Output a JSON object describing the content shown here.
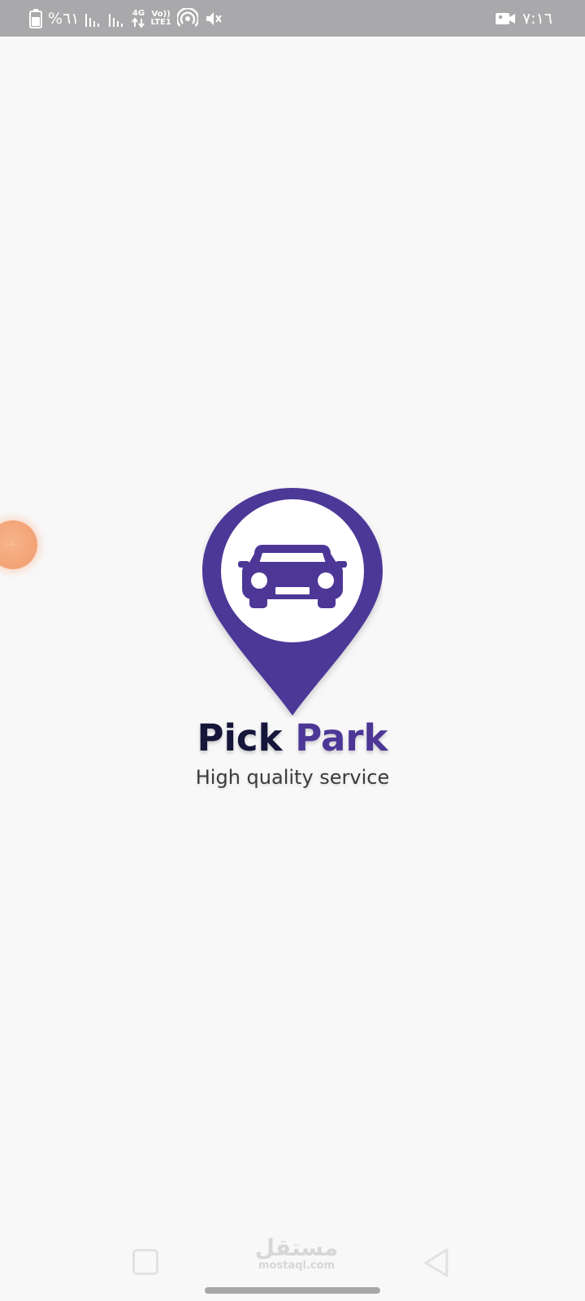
{
  "status_bar": {
    "battery_percent_label": "%٦١",
    "network_type": "4G",
    "volte_top": "Vo))",
    "volte_bottom": "LTE1",
    "time": "٧:١٦",
    "icons": [
      "battery-icon",
      "signal-icon",
      "signal-icon",
      "data-arrows-icon",
      "hotspot-icon",
      "mute-icon",
      "video-camera-icon"
    ]
  },
  "floating_bubble": {
    "label": "٠:٠١",
    "color": "#f3a579"
  },
  "logo": {
    "icon": "map-pin-car-icon",
    "title_part1": "Pick",
    "title_part2": "Park",
    "tagline": "High quality service",
    "colors": {
      "pin": "#4c3797",
      "title_dark": "#16163a",
      "title_accent": "#4c3797",
      "tagline": "#3c3c3c"
    }
  },
  "watermark": {
    "arabic": "مستقل",
    "latin": "mostaql.com"
  },
  "nav_bar": {
    "icons": [
      "recents-square-icon",
      "back-triangle-icon",
      "home-indicator"
    ]
  }
}
